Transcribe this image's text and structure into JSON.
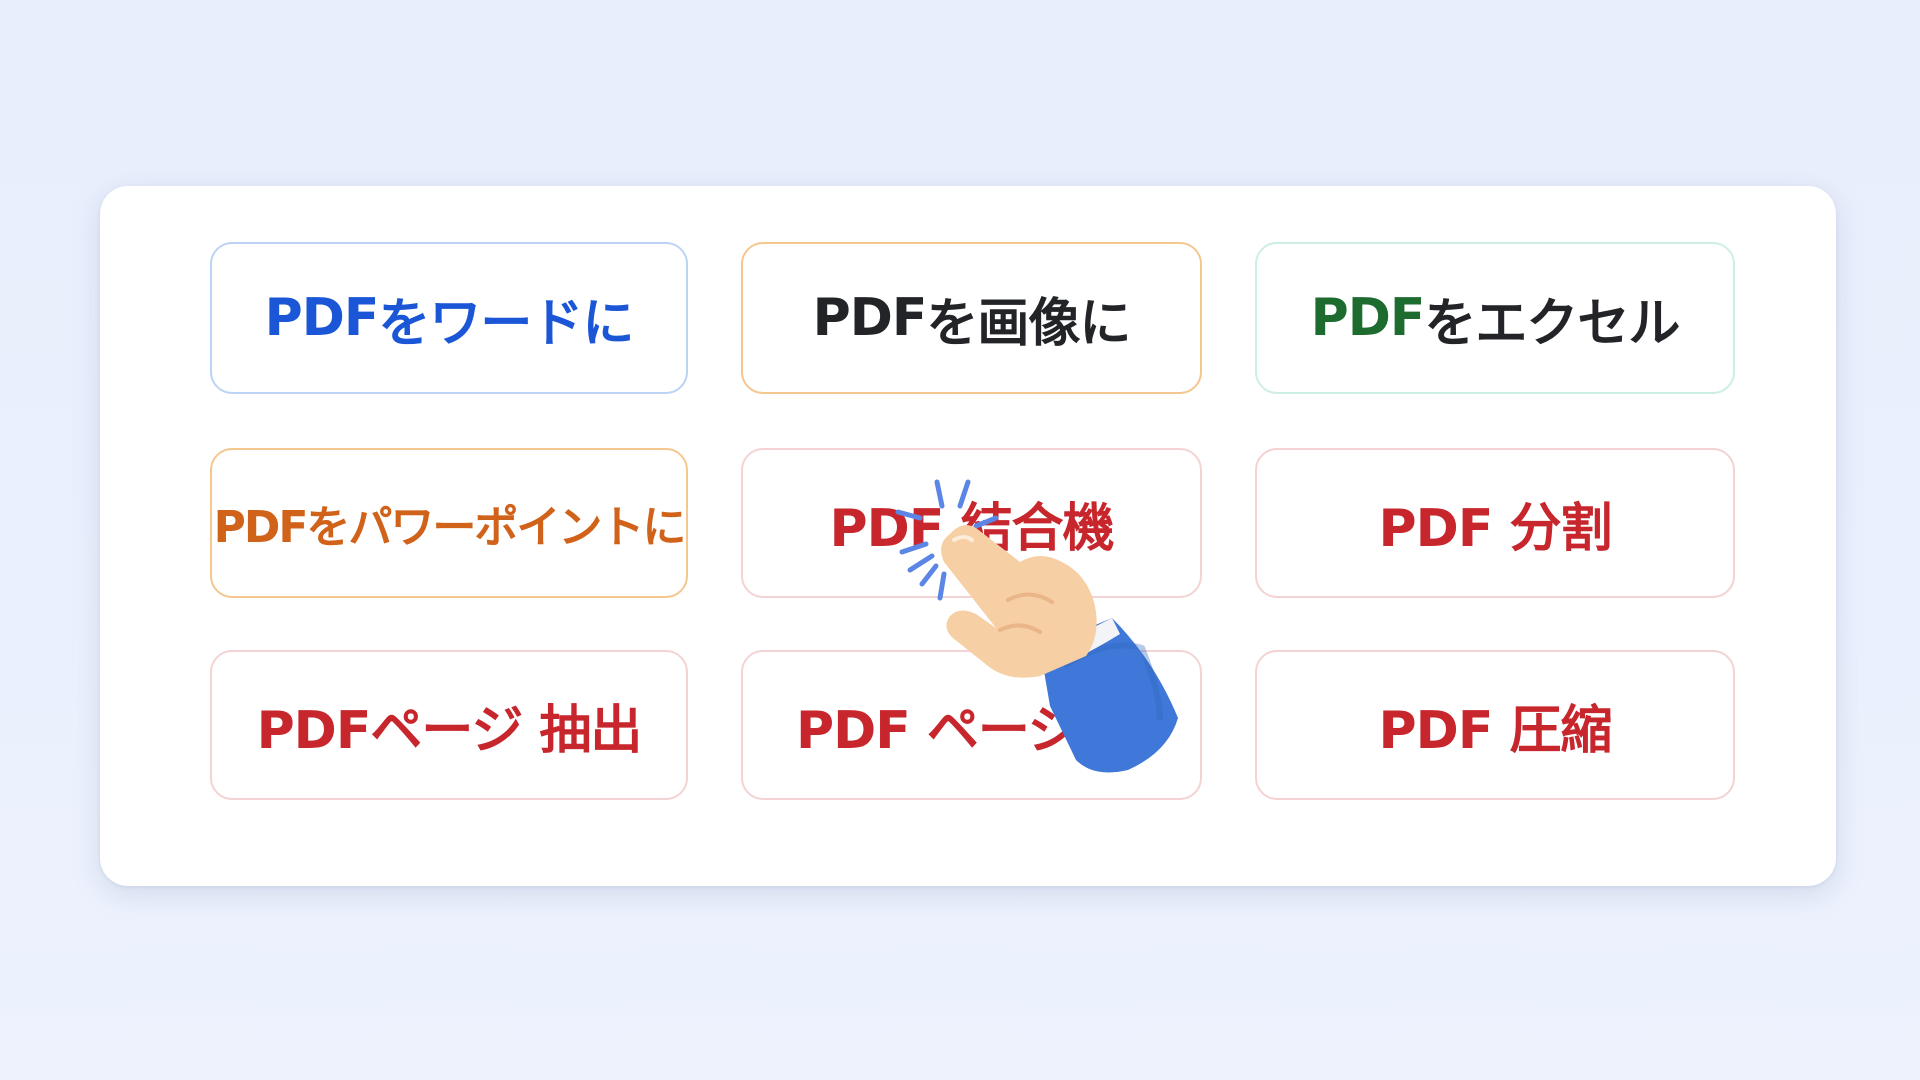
{
  "tools": [
    {
      "label_prefix": "PDF",
      "label_rest": "をワードに",
      "color": "#1a56d6",
      "border": "#bcd3f5"
    },
    {
      "label_prefix": "PDF",
      "label_rest": "を画像に",
      "color": "#222428",
      "border": "#f6c68f"
    },
    {
      "label_prefix": "PDF",
      "label_rest": "をエクセル",
      "color_prefix": "#1d6b2f",
      "color": "#222428",
      "border": "#cdeee4"
    },
    {
      "label": "PDFをパワーポイントに",
      "color": "#d0621a",
      "border": "#f6c68f"
    },
    {
      "label": "PDF 結合機",
      "color": "#c7262c",
      "border": "#f3d3d3"
    },
    {
      "label": "PDF 分割",
      "color": "#c7262c",
      "border": "#f3d3d3"
    },
    {
      "label": "PDFページ 抽出",
      "color": "#c7262c",
      "border": "#f3d3d3"
    },
    {
      "label": "PDF ページ 削",
      "color": "#c7262c",
      "border": "#f3d3d3"
    },
    {
      "label": "PDF 圧縮",
      "color": "#c7262c",
      "border": "#f3d3d3"
    }
  ],
  "cursor_icon": "pointing-hand-click-icon",
  "colors": {
    "background": "#e9eefc",
    "panel": "#ffffff",
    "sleeve": "#3f78d8",
    "skin": "#f7cfa4",
    "click_lines": "#5b86e6"
  }
}
